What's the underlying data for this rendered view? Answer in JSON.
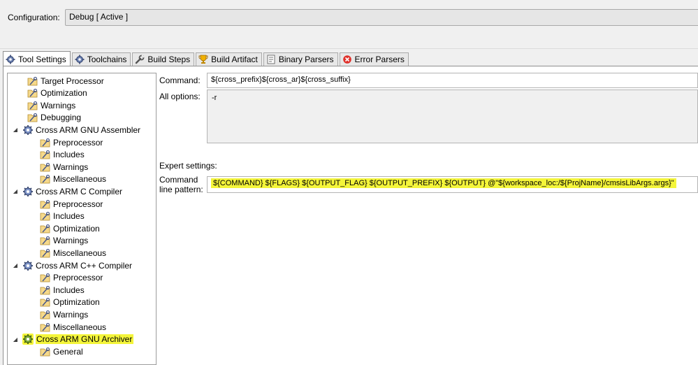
{
  "config": {
    "label": "Configuration:",
    "value": "Debug  [ Active ]"
  },
  "tabs": [
    {
      "label": "Tool Settings",
      "icon": "gear-icon",
      "active": true
    },
    {
      "label": "Toolchains",
      "icon": "gear-icon",
      "active": false
    },
    {
      "label": "Build Steps",
      "icon": "wrench-icon",
      "active": false
    },
    {
      "label": "Build Artifact",
      "icon": "trophy-icon",
      "active": false
    },
    {
      "label": "Binary Parsers",
      "icon": "binary-icon",
      "active": false
    },
    {
      "label": "Error Parsers",
      "icon": "error-icon",
      "active": false
    }
  ],
  "tree": {
    "items": [
      {
        "label": "Target Processor",
        "level": 1,
        "type": "option"
      },
      {
        "label": "Optimization",
        "level": 1,
        "type": "option"
      },
      {
        "label": "Warnings",
        "level": 1,
        "type": "option"
      },
      {
        "label": "Debugging",
        "level": 1,
        "type": "option"
      },
      {
        "label": "Cross ARM GNU Assembler",
        "level": 0,
        "type": "tool"
      },
      {
        "label": "Preprocessor",
        "level": 2,
        "type": "option"
      },
      {
        "label": "Includes",
        "level": 2,
        "type": "option"
      },
      {
        "label": "Warnings",
        "level": 2,
        "type": "option"
      },
      {
        "label": "Miscellaneous",
        "level": 2,
        "type": "option"
      },
      {
        "label": "Cross ARM C Compiler",
        "level": 0,
        "type": "tool"
      },
      {
        "label": "Preprocessor",
        "level": 2,
        "type": "option"
      },
      {
        "label": "Includes",
        "level": 2,
        "type": "option"
      },
      {
        "label": "Optimization",
        "level": 2,
        "type": "option"
      },
      {
        "label": "Warnings",
        "level": 2,
        "type": "option"
      },
      {
        "label": "Miscellaneous",
        "level": 2,
        "type": "option"
      },
      {
        "label": "Cross ARM C++ Compiler",
        "level": 0,
        "type": "tool"
      },
      {
        "label": "Preprocessor",
        "level": 2,
        "type": "option"
      },
      {
        "label": "Includes",
        "level": 2,
        "type": "option"
      },
      {
        "label": "Optimization",
        "level": 2,
        "type": "option"
      },
      {
        "label": "Warnings",
        "level": 2,
        "type": "option"
      },
      {
        "label": "Miscellaneous",
        "level": 2,
        "type": "option"
      },
      {
        "label": "Cross ARM GNU Archiver",
        "level": 0,
        "type": "tool",
        "highlighted": true
      },
      {
        "label": "General",
        "level": 2,
        "type": "option"
      }
    ]
  },
  "settings": {
    "command_label": "Command:",
    "command_value": "${cross_prefix}${cross_ar}${cross_suffix}",
    "all_options_label": "All options:",
    "all_options_value": "-r",
    "expert_label": "Expert settings:",
    "pattern_label_line1": "Command",
    "pattern_label_line2": "line pattern:",
    "pattern_value": "${COMMAND} ${FLAGS} ${OUTPUT_FLAG} ${OUTPUT_PREFIX} ${OUTPUT} @\"${workspace_loc:/${ProjName}/cmsisLibArgs.args}\""
  },
  "colors": {
    "highlight": "#f4f53a"
  }
}
